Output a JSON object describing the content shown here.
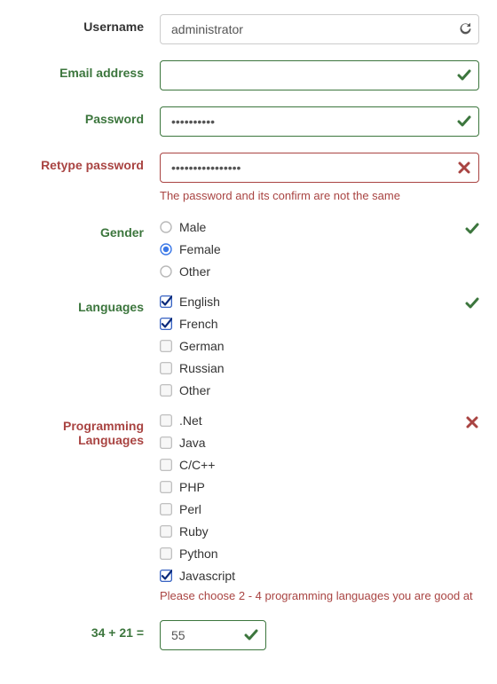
{
  "username": {
    "label": "Username",
    "value": "administrator",
    "state": "default"
  },
  "email": {
    "label": "Email address",
    "value": "",
    "state": "valid"
  },
  "password": {
    "label": "Password",
    "value": "••••••••••",
    "state": "valid"
  },
  "retype": {
    "label": "Retype password",
    "value": "••••••••••••••••",
    "state": "invalid",
    "error": "The password and its confirm are not the same"
  },
  "gender": {
    "label": "Gender",
    "state": "valid",
    "options": [
      {
        "label": "Male",
        "selected": false
      },
      {
        "label": "Female",
        "selected": true
      },
      {
        "label": "Other",
        "selected": false
      }
    ]
  },
  "languages": {
    "label": "Languages",
    "state": "valid",
    "options": [
      {
        "label": "English",
        "checked": true
      },
      {
        "label": "French",
        "checked": true
      },
      {
        "label": "German",
        "checked": false
      },
      {
        "label": "Russian",
        "checked": false
      },
      {
        "label": "Other",
        "checked": false
      }
    ]
  },
  "progLanguages": {
    "label": "Programming Languages",
    "state": "invalid",
    "help": "Please choose 2 - 4 programming languages you are good at",
    "options": [
      {
        "label": ".Net",
        "checked": false
      },
      {
        "label": "Java",
        "checked": false
      },
      {
        "label": "C/C++",
        "checked": false
      },
      {
        "label": "PHP",
        "checked": false
      },
      {
        "label": "Perl",
        "checked": false
      },
      {
        "label": "Ruby",
        "checked": false
      },
      {
        "label": "Python",
        "checked": false
      },
      {
        "label": "Javascript",
        "checked": true
      }
    ]
  },
  "captcha": {
    "label": "34 + 21 =",
    "value": "55",
    "state": "valid"
  },
  "colors": {
    "valid": "#3c763d",
    "invalid": "#a94442",
    "checkGreen": "#1e8449",
    "crossRed": "#a94442"
  }
}
